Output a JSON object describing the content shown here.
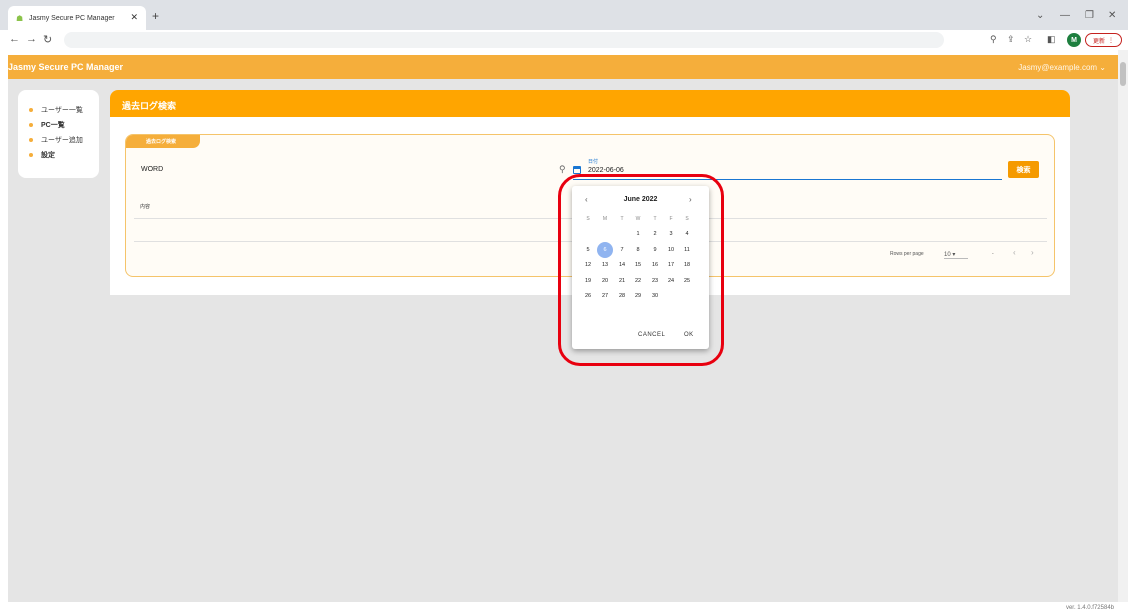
{
  "browser": {
    "tab_title": "Jasmy Secure PC Manager",
    "update_label": "更新"
  },
  "app": {
    "title": "Jasmy Secure PC Manager",
    "user": "Jasmy@example.com",
    "version": "ver. 1.4.0.f72584b"
  },
  "sidebar": {
    "items": [
      {
        "label": "ユーザー一覧"
      },
      {
        "label": "PC一覧"
      },
      {
        "label": "ユーザー追加"
      },
      {
        "label": "設定"
      }
    ]
  },
  "panel": {
    "title": "過去ログ検索",
    "card_chip": "過去ログ検索",
    "word_label": "WORD",
    "date_label": "日付",
    "date_value": "2022-06-06",
    "search_button": "検索",
    "column_header": "内容",
    "rows_per_page_label": "Rows per page",
    "rows_per_page_value": "10",
    "range_text": "-"
  },
  "datepicker": {
    "month_title": "June 2022",
    "weekdays": [
      "S",
      "M",
      "T",
      "W",
      "T",
      "F",
      "S"
    ],
    "selected_day": "6",
    "cancel_label": "CANCEL",
    "ok_label": "OK",
    "days": [
      "1",
      "2",
      "3",
      "4",
      "5",
      "6",
      "7",
      "8",
      "9",
      "10",
      "11",
      "12",
      "13",
      "14",
      "15",
      "16",
      "17",
      "18",
      "19",
      "20",
      "21",
      "22",
      "23",
      "24",
      "25",
      "26",
      "27",
      "28",
      "29",
      "30"
    ]
  }
}
